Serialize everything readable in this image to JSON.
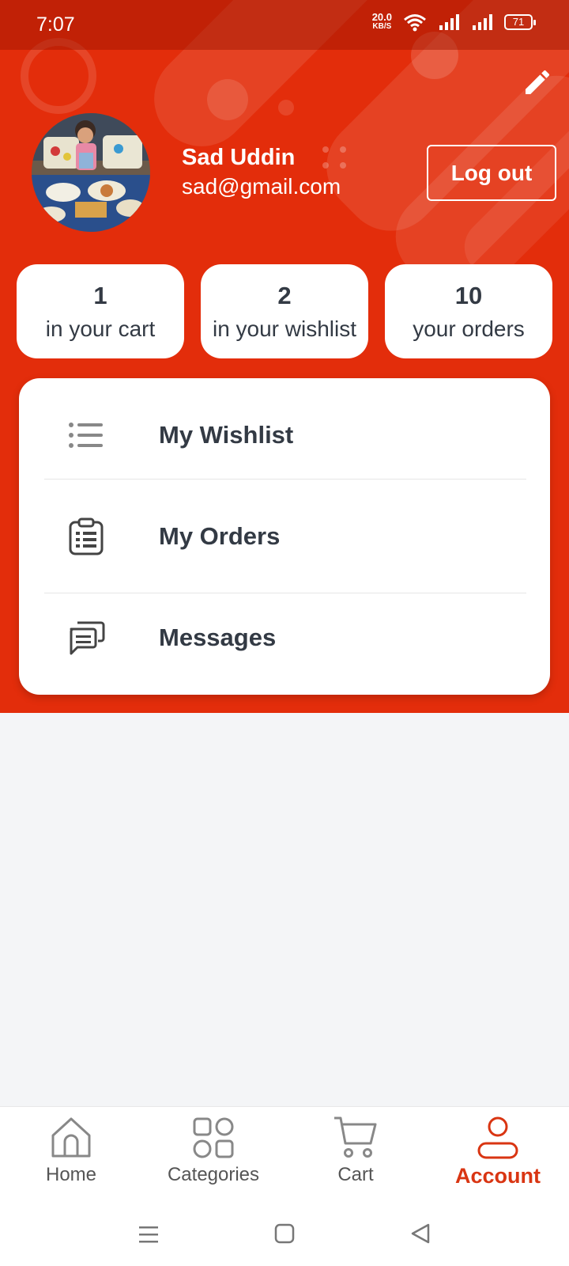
{
  "status_bar": {
    "time": "7:07",
    "net_speed": "20.0",
    "net_unit": "KB/S",
    "battery": "71"
  },
  "profile": {
    "name": "Sad Uddin",
    "email": "sad@gmail.com",
    "logout_label": "Log out"
  },
  "stats": [
    {
      "count": "1",
      "label": "in your cart"
    },
    {
      "count": "2",
      "label": "in your wishlist"
    },
    {
      "count": "10",
      "label": "your orders"
    }
  ],
  "menu": [
    {
      "label": "My Wishlist",
      "icon": "list-icon"
    },
    {
      "label": "My Orders",
      "icon": "clipboard-list-icon"
    },
    {
      "label": "Messages",
      "icon": "chat-icon"
    }
  ],
  "bottom_nav": [
    {
      "label": "Home",
      "icon": "home-icon",
      "active": false
    },
    {
      "label": "Categories",
      "icon": "categories-icon",
      "active": false
    },
    {
      "label": "Cart",
      "icon": "cart-icon",
      "active": false
    },
    {
      "label": "Account",
      "icon": "account-icon",
      "active": true
    }
  ],
  "colors": {
    "accent": "#e32d0b",
    "active_nav": "#d93512",
    "background": "#f4f5f7"
  }
}
